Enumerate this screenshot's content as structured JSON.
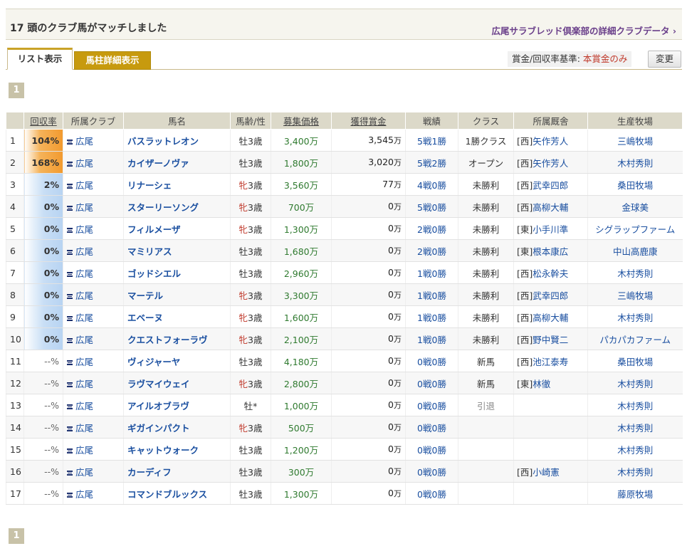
{
  "header": {
    "count": "17",
    "match_text": "頭のクラブ馬がマッチしました",
    "club_link": "広尾サラブレッド倶楽部の詳細クラブデータ ›"
  },
  "tabs": {
    "list": "リスト表示",
    "detail": "馬柱詳細表示"
  },
  "criteria": {
    "label": "賞金/回収率基準: ",
    "value": "本賞金のみ",
    "change_button": "変更"
  },
  "pager": {
    "current": "1"
  },
  "columns": {
    "rate": "回収率",
    "club": "所属クラブ",
    "name": "馬名",
    "age": "馬齢/性",
    "price": "募集価格",
    "earnings": "獲得賞金",
    "record": "戦績",
    "class": "クラス",
    "stable": "所属厩舎",
    "farm": "生産牧場"
  },
  "rows": [
    {
      "idx": "1",
      "rate": "104%",
      "rate_level": "hi",
      "club": "広尾",
      "name": "バスラットレオン",
      "sex": "牡",
      "age": "3歳",
      "female": false,
      "price": "3,400万",
      "earn": "3,545",
      "unit": "万",
      "record": "5戦1勝",
      "class": "1勝クラス",
      "region": "[西]",
      "trainer": "矢作芳人",
      "farm": "三嶋牧場"
    },
    {
      "idx": "2",
      "rate": "168%",
      "rate_level": "hi",
      "club": "広尾",
      "name": "カイザーノヴァ",
      "sex": "牡",
      "age": "3歳",
      "female": false,
      "price": "1,800万",
      "earn": "3,020",
      "unit": "万",
      "record": "5戦2勝",
      "class": "オープン",
      "region": "[西]",
      "trainer": "矢作芳人",
      "farm": "木村秀則"
    },
    {
      "idx": "3",
      "rate": "2%",
      "rate_level": "lo",
      "club": "広尾",
      "name": "リナーシェ",
      "sex": "牝",
      "age": "3歳",
      "female": true,
      "price": "3,560万",
      "earn": "77",
      "unit": "万",
      "record": "4戦0勝",
      "class": "未勝利",
      "region": "[西]",
      "trainer": "武幸四郎",
      "farm": "桑田牧場"
    },
    {
      "idx": "4",
      "rate": "0%",
      "rate_level": "lo",
      "club": "広尾",
      "name": "スターリーソング",
      "sex": "牝",
      "age": "3歳",
      "female": true,
      "price": "700万",
      "earn": "0",
      "unit": "万",
      "record": "5戦0勝",
      "class": "未勝利",
      "region": "[西]",
      "trainer": "高柳大輔",
      "farm": "金球美"
    },
    {
      "idx": "5",
      "rate": "0%",
      "rate_level": "lo",
      "club": "広尾",
      "name": "フィルメーザ",
      "sex": "牝",
      "age": "3歳",
      "female": true,
      "price": "1,300万",
      "earn": "0",
      "unit": "万",
      "record": "2戦0勝",
      "class": "未勝利",
      "region": "[東]",
      "trainer": "小手川準",
      "farm": "シグラップファーム"
    },
    {
      "idx": "6",
      "rate": "0%",
      "rate_level": "lo",
      "club": "広尾",
      "name": "マミリアス",
      "sex": "牡",
      "age": "3歳",
      "female": false,
      "price": "1,680万",
      "earn": "0",
      "unit": "万",
      "record": "2戦0勝",
      "class": "未勝利",
      "region": "[東]",
      "trainer": "根本康広",
      "farm": "中山高鹿康"
    },
    {
      "idx": "7",
      "rate": "0%",
      "rate_level": "lo",
      "club": "広尾",
      "name": "ゴッドシエル",
      "sex": "牡",
      "age": "3歳",
      "female": false,
      "price": "2,960万",
      "earn": "0",
      "unit": "万",
      "record": "1戦0勝",
      "class": "未勝利",
      "region": "[西]",
      "trainer": "松永幹夫",
      "farm": "木村秀則"
    },
    {
      "idx": "8",
      "rate": "0%",
      "rate_level": "lo",
      "club": "広尾",
      "name": "マーテル",
      "sex": "牝",
      "age": "3歳",
      "female": true,
      "price": "3,300万",
      "earn": "0",
      "unit": "万",
      "record": "1戦0勝",
      "class": "未勝利",
      "region": "[西]",
      "trainer": "武幸四郎",
      "farm": "三嶋牧場"
    },
    {
      "idx": "9",
      "rate": "0%",
      "rate_level": "lo",
      "club": "広尾",
      "name": "エベーヌ",
      "sex": "牝",
      "age": "3歳",
      "female": true,
      "price": "1,600万",
      "earn": "0",
      "unit": "万",
      "record": "1戦0勝",
      "class": "未勝利",
      "region": "[西]",
      "trainer": "高柳大輔",
      "farm": "木村秀則"
    },
    {
      "idx": "10",
      "rate": "0%",
      "rate_level": "lo",
      "club": "広尾",
      "name": "クエストフォーラヴ",
      "sex": "牝",
      "age": "3歳",
      "female": true,
      "price": "2,100万",
      "earn": "0",
      "unit": "万",
      "record": "1戦0勝",
      "class": "未勝利",
      "region": "[西]",
      "trainer": "野中賢二",
      "farm": "パカパカファーム"
    },
    {
      "idx": "11",
      "rate": "--%",
      "rate_level": "none",
      "club": "広尾",
      "name": "ヴィジャーヤ",
      "sex": "牡",
      "age": "3歳",
      "female": false,
      "price": "4,180万",
      "earn": "0",
      "unit": "万",
      "record": "0戦0勝",
      "class": "新馬",
      "region": "[西]",
      "trainer": "池江泰寿",
      "farm": "桑田牧場"
    },
    {
      "idx": "12",
      "rate": "--%",
      "rate_level": "none",
      "club": "広尾",
      "name": "ラヴマイウェイ",
      "sex": "牝",
      "age": "3歳",
      "female": true,
      "price": "2,800万",
      "earn": "0",
      "unit": "万",
      "record": "0戦0勝",
      "class": "新馬",
      "region": "[東]",
      "trainer": "林徹",
      "farm": "木村秀則"
    },
    {
      "idx": "13",
      "rate": "--%",
      "rate_level": "none",
      "club": "広尾",
      "name": "アイルオブラヴ",
      "sex": "牡",
      "age": "*",
      "female": false,
      "price": "1,000万",
      "earn": "0",
      "unit": "万",
      "record": "0戦0勝",
      "class": "引退",
      "region": "",
      "trainer": "",
      "farm": "木村秀則"
    },
    {
      "idx": "14",
      "rate": "--%",
      "rate_level": "none",
      "club": "広尾",
      "name": "ギガインパクト",
      "sex": "牝",
      "age": "3歳",
      "female": true,
      "price": "500万",
      "earn": "0",
      "unit": "万",
      "record": "0戦0勝",
      "class": "",
      "region": "",
      "trainer": "",
      "farm": "木村秀則"
    },
    {
      "idx": "15",
      "rate": "--%",
      "rate_level": "none",
      "club": "広尾",
      "name": "キャットウォーク",
      "sex": "牡",
      "age": "3歳",
      "female": false,
      "price": "1,200万",
      "earn": "0",
      "unit": "万",
      "record": "0戦0勝",
      "class": "",
      "region": "",
      "trainer": "",
      "farm": "木村秀則"
    },
    {
      "idx": "16",
      "rate": "--%",
      "rate_level": "none",
      "club": "広尾",
      "name": "カーディフ",
      "sex": "牡",
      "age": "3歳",
      "female": false,
      "price": "300万",
      "earn": "0",
      "unit": "万",
      "record": "0戦0勝",
      "class": "",
      "region": "[西]",
      "trainer": "小崎憲",
      "farm": "木村秀則"
    },
    {
      "idx": "17",
      "rate": "--%",
      "rate_level": "none",
      "club": "広尾",
      "name": "コマンドブルックス",
      "sex": "牡",
      "age": "3歳",
      "female": false,
      "price": "1,300万",
      "earn": "0",
      "unit": "万",
      "record": "0戦0勝",
      "class": "",
      "region": "",
      "trainer": "",
      "farm": "藤原牧場"
    }
  ],
  "colors": {
    "rate_high": "#f29a2e",
    "rate_low": "#b7d3f2",
    "link": "#1a4fa0",
    "female": "#c0392b",
    "price": "#2f7a2f",
    "tab_active_detail": "#c79a0e"
  }
}
